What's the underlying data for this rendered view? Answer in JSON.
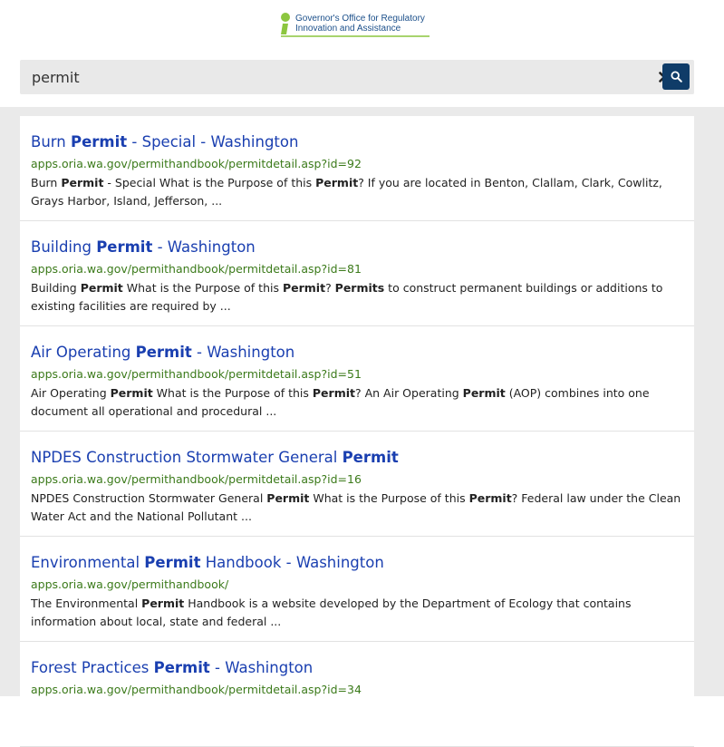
{
  "logo": {
    "line1": "Governor's Office for Regulatory",
    "line2": "Innovation and Assistance"
  },
  "search": {
    "value": "permit"
  },
  "colors": {
    "title": "#1a3fb0",
    "url": "#3b7a1a",
    "search_button": "#0f3c68"
  },
  "results": [
    {
      "title_parts": [
        "Burn ",
        "Permit",
        " - Special - Washington"
      ],
      "url": "apps.oria.wa.gov/permithandbook/permitdetail.asp?id=92",
      "snippet_parts": [
        "Burn ",
        "Permit",
        " - Special What is the Purpose of this ",
        "Permit",
        "? If you are located in Benton, Clallam, Clark, Cowlitz, Grays Harbor, Island, Jefferson, ..."
      ]
    },
    {
      "title_parts": [
        "Building ",
        "Permit",
        " - Washington"
      ],
      "url": "apps.oria.wa.gov/permithandbook/permitdetail.asp?id=81",
      "snippet_parts": [
        "Building ",
        "Permit",
        " What is the Purpose of this ",
        "Permit",
        "? ",
        "Permits",
        " to construct permanent buildings or additions to existing facilities are required by ..."
      ]
    },
    {
      "title_parts": [
        "Air Operating ",
        "Permit",
        " - Washington"
      ],
      "url": "apps.oria.wa.gov/permithandbook/permitdetail.asp?id=51",
      "snippet_parts": [
        "Air Operating ",
        "Permit",
        " What is the Purpose of this ",
        "Permit",
        "? An Air Operating ",
        "Permit",
        " (AOP) combines into one document all operational and procedural ..."
      ]
    },
    {
      "title_parts": [
        "NPDES Construction Stormwater General ",
        "Permit",
        ""
      ],
      "url": "apps.oria.wa.gov/permithandbook/permitdetail.asp?id=16",
      "snippet_parts": [
        "NPDES Construction Stormwater General ",
        "Permit",
        " What is the Purpose of this ",
        "Permit",
        "? Federal law under the Clean Water Act and the National Pollutant ..."
      ]
    },
    {
      "title_parts": [
        "Environmental ",
        "Permit",
        " Handbook - Washington"
      ],
      "url": "apps.oria.wa.gov/permithandbook/",
      "snippet_parts": [
        "The Environmental ",
        "Permit",
        " Handbook is a website developed by the Department of Ecology that contains information about local, state and federal ..."
      ]
    },
    {
      "title_parts": [
        "Forest Practices ",
        "Permit",
        " - Washington"
      ],
      "url": "apps.oria.wa.gov/permithandbook/permitdetail.asp?id=34",
      "snippet_parts": []
    }
  ]
}
